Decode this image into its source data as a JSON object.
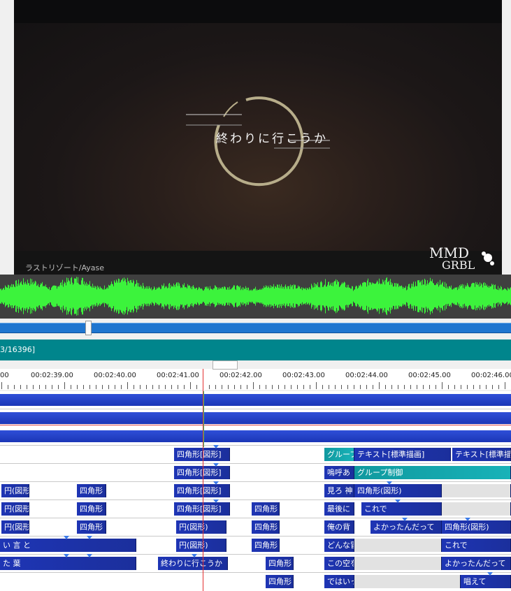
{
  "preview": {
    "lyric": "終わりに行こうか",
    "credit": "ラストリゾート/Ayase",
    "logo_text": "MMD GRBL"
  },
  "frame_counter": "3/16396]",
  "ruler": {
    "labels": [
      "00",
      "00:02:39.00",
      "00:02:40.00",
      "00:02:41.00",
      "00:02:42.00",
      "00:02:43.00",
      "00:02:44.00",
      "00:02:45.00",
      "00:02:46.00"
    ]
  },
  "colors": {
    "seek_bar": "#1f75cf",
    "frame_bar": "#00858c",
    "waveform": "#3cf33c",
    "clip_blue": "#1e35b5",
    "clip_teal": "#18b2b8",
    "playhead": "#e23030"
  },
  "layers": {
    "row1": {
      "clips": [
        {
          "label": "四角形[図形]"
        },
        {
          "label": "グループ"
        },
        {
          "label": "テキスト[標準描画]"
        },
        {
          "label": "テキスト[標準描画]"
        }
      ]
    },
    "row2": {
      "clips": [
        {
          "label": "四角形[図形]"
        },
        {
          "label": "嗚呼あ"
        },
        {
          "label": "グループ制御"
        }
      ]
    },
    "row3": {
      "clips": [
        {
          "label": "円(図形"
        },
        {
          "label": "四角形"
        },
        {
          "label": "四角形[図形]"
        },
        {
          "label": "見ろ 神"
        },
        {
          "label": "四角形(図形)"
        }
      ]
    },
    "row4": {
      "clips": [
        {
          "label": "円(図形"
        },
        {
          "label": "四角形"
        },
        {
          "label": "四角形[図形]"
        },
        {
          "label": "四角形"
        },
        {
          "label": "最後に"
        },
        {
          "label": "これで"
        }
      ]
    },
    "row5": {
      "clips": [
        {
          "label": "円(図形"
        },
        {
          "label": "四角形"
        },
        {
          "label": "円(図形)"
        },
        {
          "label": "四角形"
        },
        {
          "label": "俺の背"
        },
        {
          "label": "よかったんだって"
        },
        {
          "label": "四角形(図形)"
        }
      ]
    },
    "row6": {
      "clips": [
        {
          "label": "い 言 と"
        },
        {
          "label": "円(図形)"
        },
        {
          "label": "四角形"
        },
        {
          "label": "どんな冒"
        },
        {
          "label": "これで"
        }
      ]
    },
    "row7": {
      "clips": [
        {
          "label": "た 葉"
        },
        {
          "label": "終わりに行こうか"
        },
        {
          "label": "四角形"
        },
        {
          "label": "この空を"
        },
        {
          "label": "よかったんだって"
        }
      ]
    },
    "row8": {
      "clips": [
        {
          "label": "四角形"
        },
        {
          "label": "ではいっ"
        },
        {
          "label": "唱えて"
        }
      ]
    }
  }
}
